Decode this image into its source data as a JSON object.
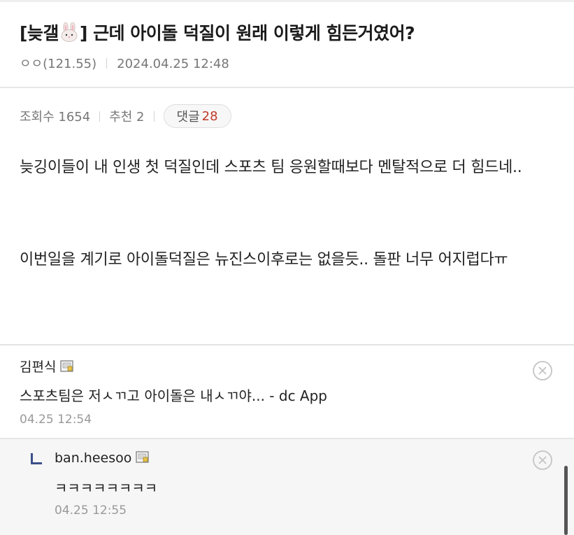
{
  "post": {
    "title_prefix": "[늦갤",
    "title_suffix": "] 근데 아이돌 덕질이 원래 이렇게 힘든거였어?",
    "author": "ㅇㅇ(121.55)",
    "date": "2024.04.25 12:48",
    "views": "조회수 1654",
    "recommend": "추천 2",
    "comment_label": "댓글",
    "comment_count": "28",
    "paragraph1": "늦깅이들이 내 인생 첫 덕질인데 스포츠 팀 응원할때보다 멘탈적으로 더 힘드네..",
    "paragraph2": "이번일을 계기로 아이돌덕질은 뉴진스이후로는 없을듯..  돌판 너무 어지럽다ㅠ"
  },
  "comments": [
    {
      "author": "김편식",
      "text": "스포츠팀은 저ㅅㄲ고 아이돌은 내ㅅㄲ야... - dc App",
      "date": "04.25 12:54"
    },
    {
      "author": "ban.heesoo",
      "text": "ㅋㅋㅋㅋㅋㅋㅋㅋ",
      "date": "04.25 12:55"
    }
  ],
  "icons": {
    "title_emoji": "bunny-emoji-icon",
    "user_badge": "gallery-user-badge-icon",
    "delete": "circle-close-icon",
    "reply": "reply-arrow-icon"
  },
  "colors": {
    "comment_count": "#c0392b",
    "reply_mark": "#3b4f8a"
  }
}
